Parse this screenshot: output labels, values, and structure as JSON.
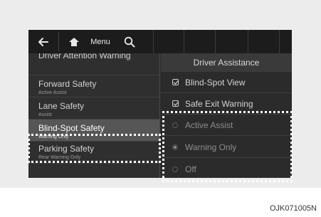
{
  "toolbar": {
    "back_icon": "back-arrow-icon",
    "home_icon": "home-icon",
    "menu_label": "Menu",
    "search_icon": "search-icon"
  },
  "header": {
    "title": "Driver Assistance"
  },
  "left_menu": {
    "items": [
      {
        "title": "Driver Attention Warning",
        "subtitle": ""
      },
      {
        "title": "Forward Safety",
        "subtitle": "Active Assist"
      },
      {
        "title": "Lane Safety",
        "subtitle": "Assist"
      },
      {
        "title": "Blind-Spot Safety",
        "subtitle": "Warning Only",
        "selected": true
      },
      {
        "title": "Parking Safety",
        "subtitle": "Rear Warning Only"
      }
    ]
  },
  "right_options": {
    "checkboxes": [
      {
        "label": "Blind-Spot View",
        "checked": true
      },
      {
        "label": "Safe Exit Warning",
        "checked": true
      }
    ],
    "radios": [
      {
        "label": "Active Assist",
        "selected": false
      },
      {
        "label": "Warning Only",
        "selected": true
      },
      {
        "label": "Off",
        "selected": false
      }
    ]
  },
  "caption": "OJK071005N"
}
